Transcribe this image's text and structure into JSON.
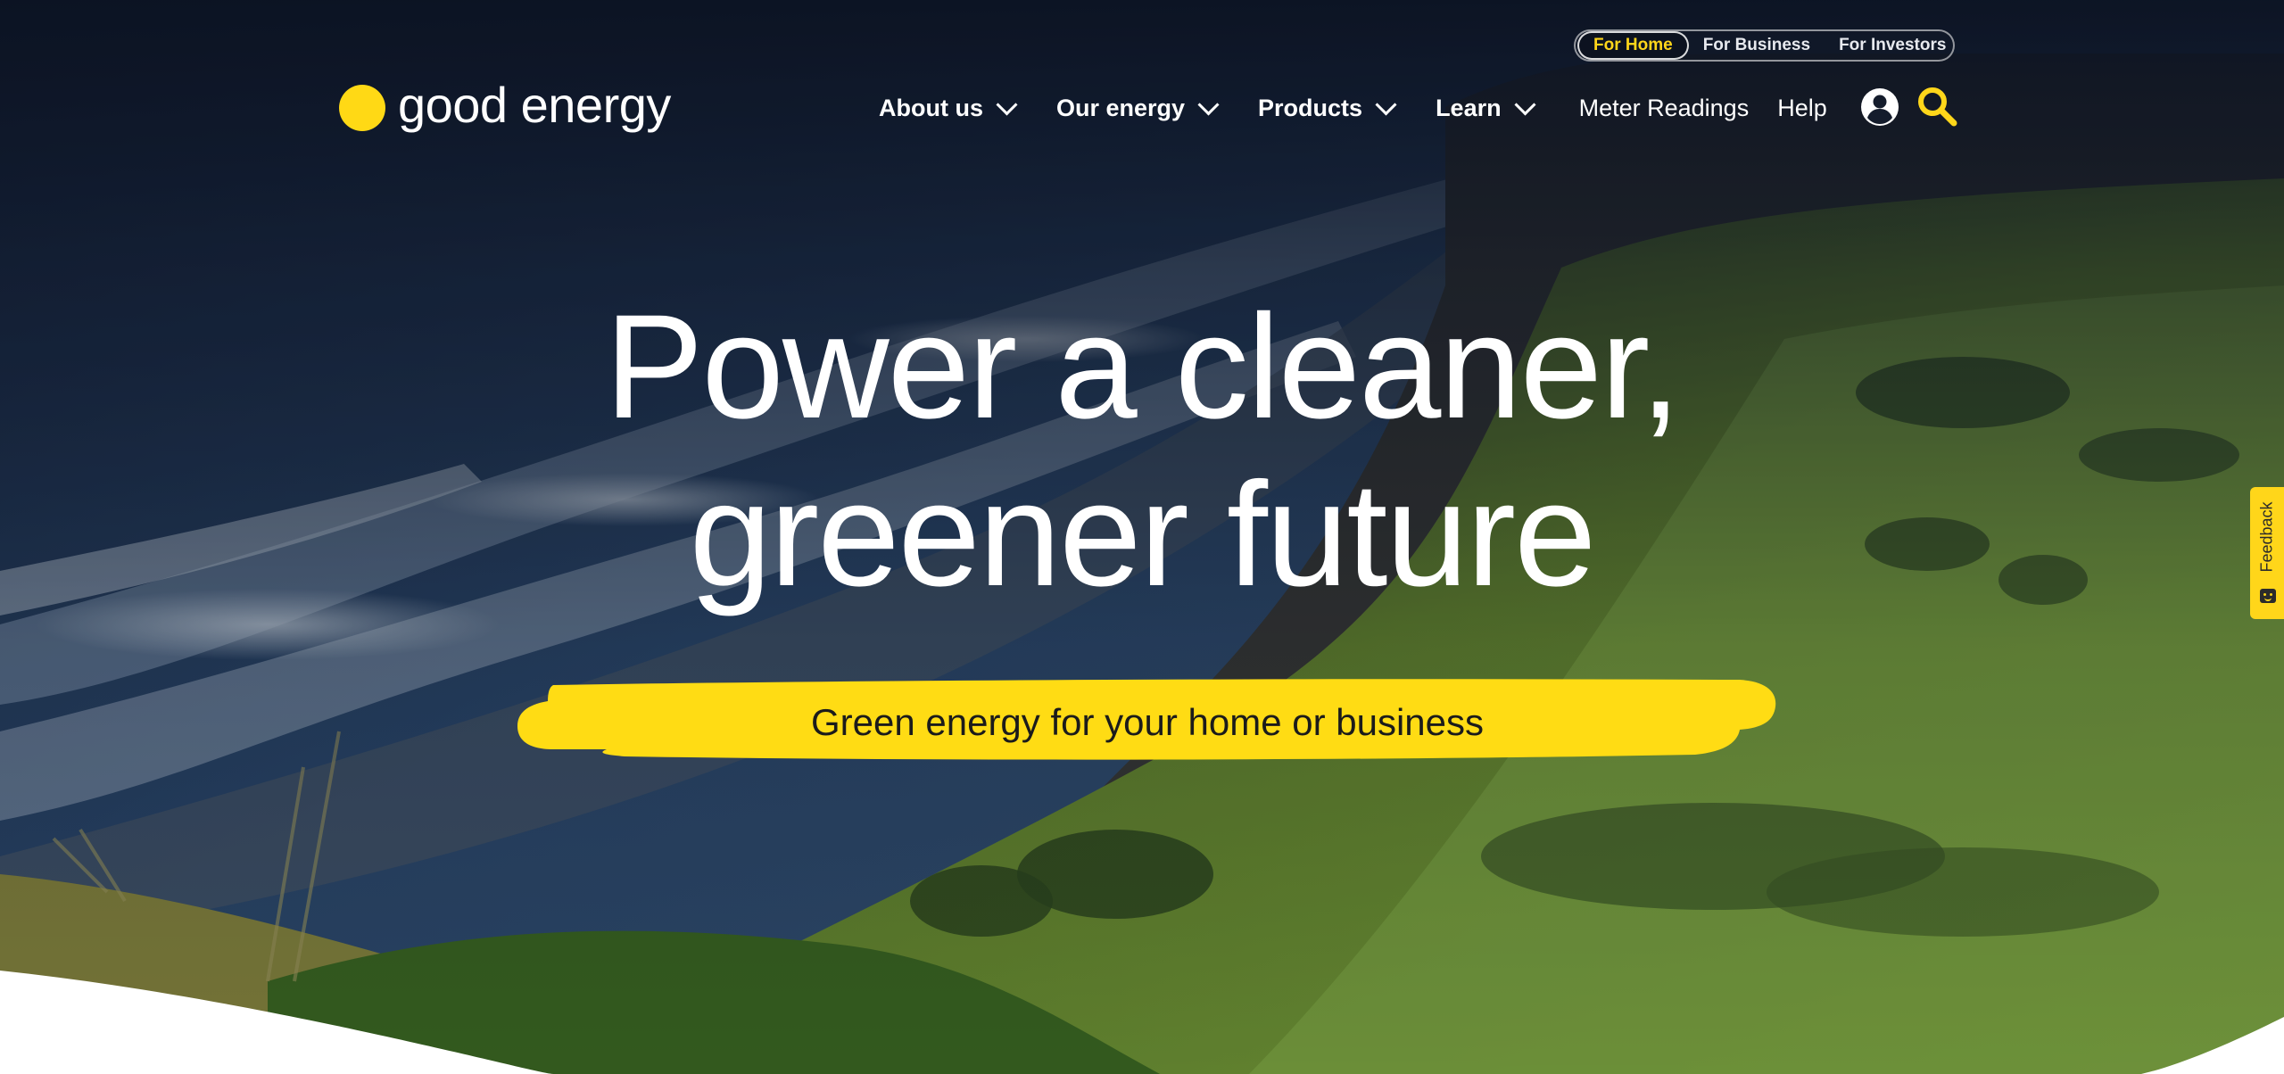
{
  "audience_switcher": {
    "tabs": [
      {
        "label": "For Home",
        "active": true
      },
      {
        "label": "For Business",
        "active": false
      },
      {
        "label": "For Investors",
        "active": false
      }
    ]
  },
  "header": {
    "logo_text": "good energy",
    "nav": [
      {
        "label": "About us",
        "has_dropdown": true
      },
      {
        "label": "Our energy",
        "has_dropdown": true
      },
      {
        "label": "Products",
        "has_dropdown": true
      },
      {
        "label": "Learn",
        "has_dropdown": true
      },
      {
        "label": "Meter Readings",
        "has_dropdown": false
      },
      {
        "label": "Help",
        "has_dropdown": false
      }
    ],
    "icons": {
      "account": "user-circle-icon",
      "search": "search-icon"
    }
  },
  "hero": {
    "title_line1": "Power a cleaner,",
    "title_line2": "greener future",
    "tagline": "Green energy for your home or business"
  },
  "feedback": {
    "label": "Feedback",
    "icon": "smiley-icon"
  },
  "colors": {
    "brand_yellow": "#ffd915",
    "text_white": "#ffffff",
    "text_dark": "#1b1b1b"
  }
}
